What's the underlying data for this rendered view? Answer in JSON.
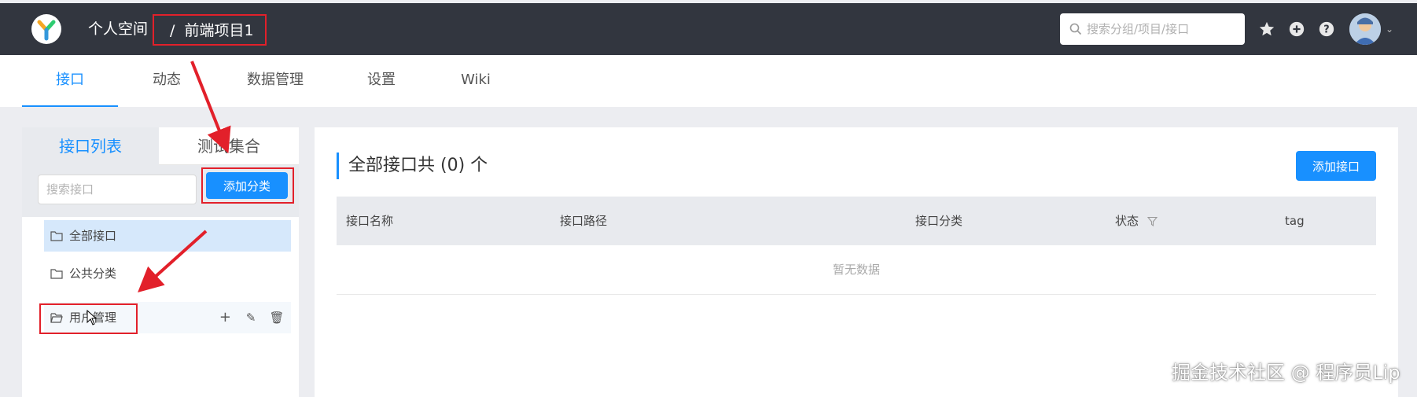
{
  "header": {
    "breadcrumb_home": "个人空间",
    "breadcrumb_separator": "/",
    "breadcrumb_project": "前端项目1",
    "search_placeholder": "搜索分组/项目/接口",
    "icons": [
      "star-icon",
      "plus-circle-icon",
      "question-icon",
      "avatar",
      "chevron-down-icon"
    ]
  },
  "nav": {
    "tabs": [
      {
        "label": "接口",
        "active": true
      },
      {
        "label": "动态",
        "active": false
      },
      {
        "label": "数据管理",
        "active": false
      },
      {
        "label": "设置",
        "active": false
      },
      {
        "label": "Wiki",
        "active": false
      }
    ]
  },
  "sidebar": {
    "tab_interfaces": "接口列表",
    "tab_collections": "测试集合",
    "search_placeholder": "搜索接口",
    "add_category_label": "添加分类",
    "items": [
      {
        "label": "全部接口",
        "selected": true
      },
      {
        "label": "公共分类",
        "selected": false
      },
      {
        "label": "用户管理",
        "selected": false,
        "actions": [
          "+",
          "✎",
          "🗑"
        ]
      }
    ]
  },
  "main": {
    "title": "全部接口共 (0) 个",
    "add_interface_label": "添加接口",
    "columns": [
      "接口名称",
      "接口路径",
      "接口分类",
      "状态",
      "tag"
    ],
    "empty_text": "暂无数据"
  },
  "watermark": "掘金技术社区 @ 程序员Lip",
  "colors": {
    "header_bg": "#32363f",
    "accent": "#1890ff",
    "annotation_red": "#e2202a",
    "selected_bg": "#d6e8fb"
  }
}
